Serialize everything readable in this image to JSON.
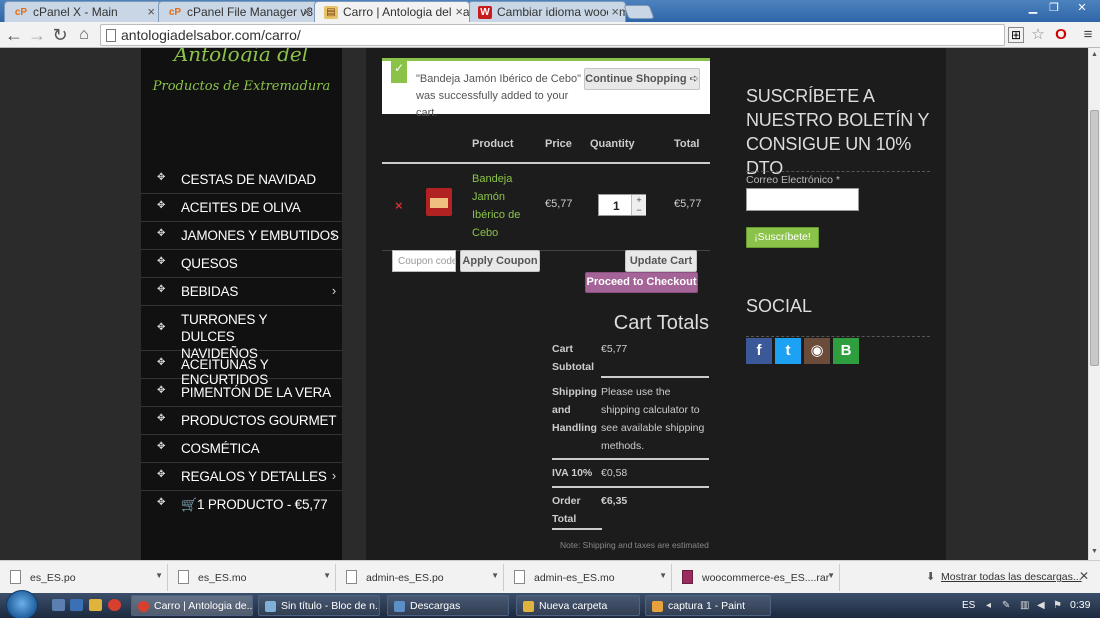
{
  "browser": {
    "tabs": [
      {
        "title": "cPanel X - Main",
        "icon": "cpanel-icon"
      },
      {
        "title": "cPanel File Manager v3",
        "icon": "cpanel-icon"
      },
      {
        "title": "Carro | Antologia del Sabor",
        "icon": "book-icon"
      },
      {
        "title": "Cambiar idioma woocomm",
        "icon": "wu-icon"
      }
    ],
    "url": "antologiadelsabor.com/carro/"
  },
  "sidebar": {
    "logo_script": "Antologia del Sabor",
    "logo_subtitle": "Productos de Extremadura",
    "menu": [
      {
        "label": "CESTAS DE NAVIDAD",
        "has_sub": false
      },
      {
        "label": "ACEITES DE OLIVA",
        "has_sub": false
      },
      {
        "label": "JAMONES Y EMBUTIDOS",
        "has_sub": true
      },
      {
        "label": "QUESOS",
        "has_sub": false
      },
      {
        "label": "BEBIDAS",
        "has_sub": true
      },
      {
        "label": "TURRONES Y DULCES NAVIDEÑOS",
        "has_sub": false
      },
      {
        "label": "ACEITUNAS Y ENCURTIDOS",
        "has_sub": false
      },
      {
        "label": "PIMENTÓN DE LA VERA",
        "has_sub": false
      },
      {
        "label": "PRODUCTOS GOURMET",
        "has_sub": false
      },
      {
        "label": "COSMÉTICA",
        "has_sub": false
      },
      {
        "label": "REGALOS Y DETALLES",
        "has_sub": true
      }
    ],
    "cart_link": "1 PRODUCTO - €5,77"
  },
  "notice": {
    "message": "\"Bandeja Jamón Ibérico de Cebo\" was successfully added to your cart.",
    "continue_label": "Continue Shopping ➪"
  },
  "cart": {
    "headers": {
      "product": "Product",
      "price": "Price",
      "quantity": "Quantity",
      "total": "Total"
    },
    "item": {
      "name": "Bandeja Jamón Ibérico de Cebo",
      "price": "€5,77",
      "quantity": "1",
      "total": "€5,77"
    },
    "coupon_placeholder": "Coupon code",
    "apply_coupon": "Apply Coupon",
    "update_cart": "Update Cart",
    "checkout": "Proceed to Checkout"
  },
  "totals": {
    "title": "Cart Totals",
    "subtotal_label": "Cart Subtotal",
    "subtotal_value": "€5,77",
    "shipping_label": "Shipping and Handling",
    "shipping_value": "Please use the shipping calculator to see available shipping methods.",
    "tax_label": "IVA 10%",
    "tax_value": "€0,58",
    "order_label": "Order Total",
    "order_value": "€6,35",
    "note": "Note: Shipping and taxes are estimated"
  },
  "newsletter": {
    "title": "SUSCRÍBETE A NUESTRO BOLETÍN Y CONSIGUE UN 10% DTO",
    "email_label": "Correo Electrónico *",
    "button": "¡Suscríbete!"
  },
  "social": {
    "title": "SOCIAL",
    "networks": [
      {
        "name": "facebook-icon",
        "glyph": "f",
        "color": "#3b5998"
      },
      {
        "name": "twitter-icon",
        "glyph": "t",
        "color": "#1da1f2"
      },
      {
        "name": "instagram-icon",
        "glyph": "◉",
        "color": "#6b4b3a"
      },
      {
        "name": "blogger-b-icon",
        "glyph": "B",
        "color": "#2e9e3f"
      }
    ]
  },
  "downloads": {
    "files": [
      "es_ES.po",
      "es_ES.mo",
      "admin-es_ES.po",
      "admin-es_ES.mo",
      "woocommerce-es_ES....rar"
    ],
    "show_all": "Mostrar todas las descargas..."
  },
  "taskbar": {
    "tasks": [
      "Carro | Antologia de...",
      "Sin título - Bloc de n...",
      "Descargas",
      "Nueva carpeta",
      "captura 1 - Paint"
    ],
    "lang": "ES",
    "clock": "0:39"
  },
  "colors": {
    "accent_green": "#8bc34a",
    "checkout_purple": "#a46497",
    "remove_red": "#d43232"
  }
}
